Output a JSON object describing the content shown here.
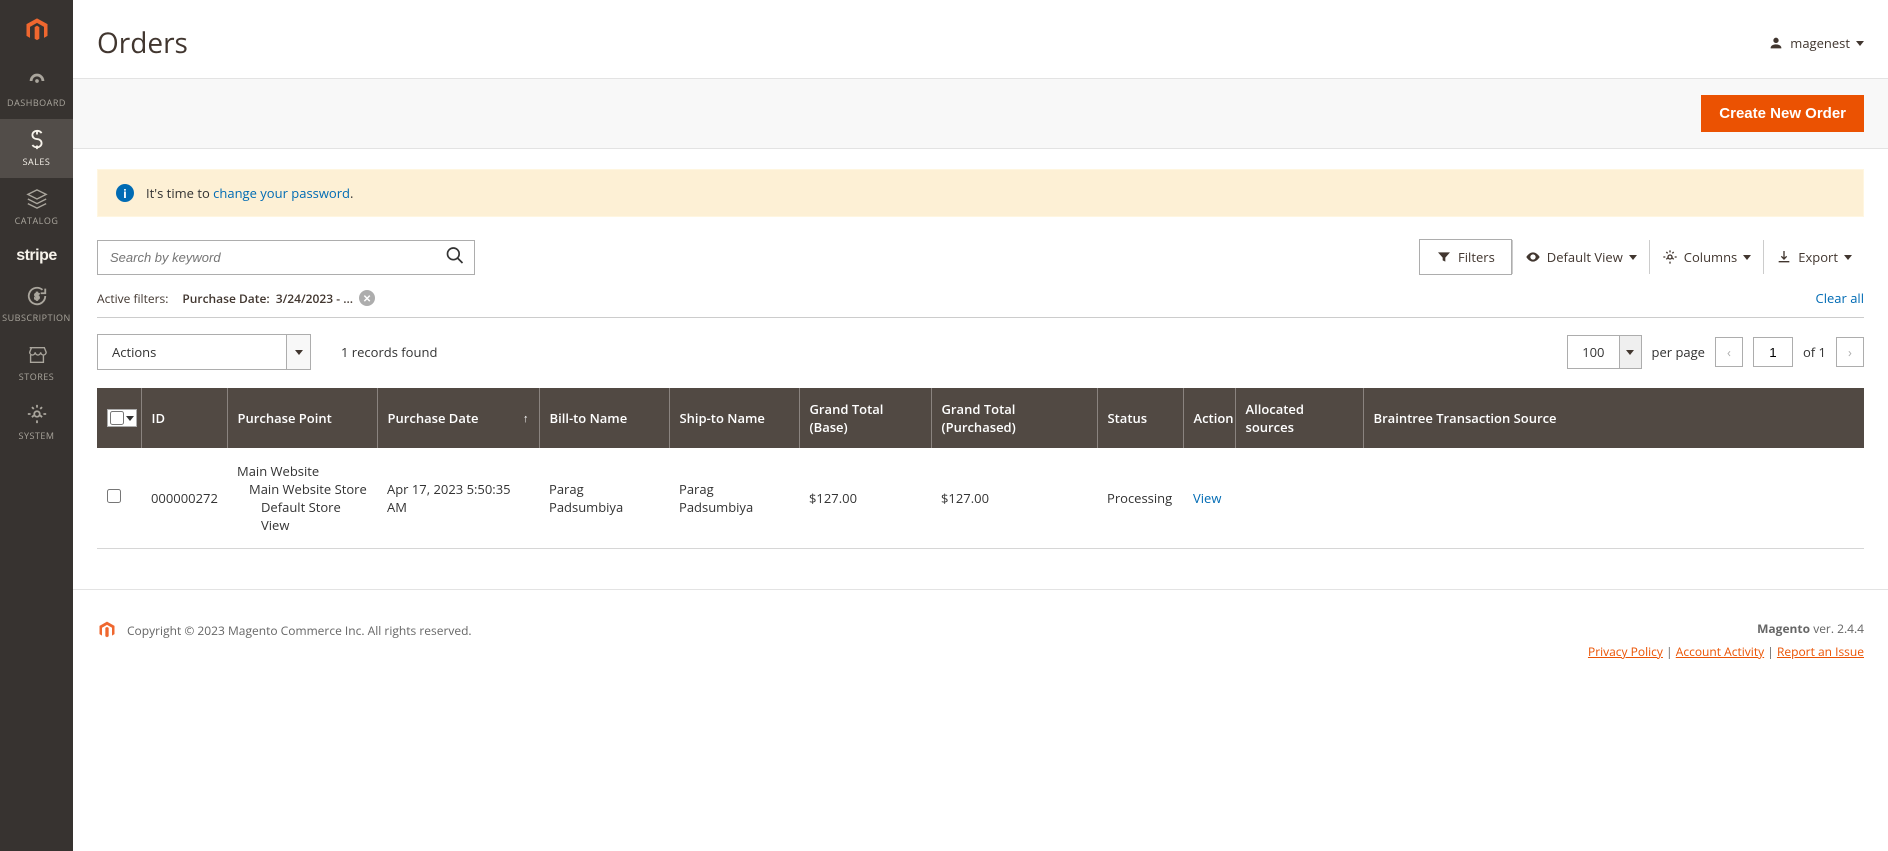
{
  "sidebar": {
    "items": [
      {
        "label": "Dashboard",
        "name": "dashboard"
      },
      {
        "label": "Sales",
        "name": "sales"
      },
      {
        "label": "Catalog",
        "name": "catalog"
      },
      {
        "label": "stripe",
        "name": "stripe"
      },
      {
        "label": "Subscription",
        "name": "subscription"
      },
      {
        "label": "Stores",
        "name": "stores"
      },
      {
        "label": "System",
        "name": "system"
      }
    ]
  },
  "header": {
    "title": "Orders",
    "user_name": "magenest"
  },
  "actions": {
    "create_new_order": "Create New Order"
  },
  "notice": {
    "prefix": "It's time to ",
    "link": "change your password",
    "suffix": "."
  },
  "search": {
    "placeholder": "Search by keyword"
  },
  "toolbar": {
    "filters": "Filters",
    "default_view": "Default View",
    "columns": "Columns",
    "export": "Export"
  },
  "active_filters": {
    "label": "Active filters:",
    "chip_label": "Purchase Date:",
    "chip_value": "3/24/2023 - ...",
    "clear_all": "Clear all"
  },
  "controls": {
    "actions_label": "Actions",
    "records_found": "1 records found",
    "page_size": "100",
    "per_page": "per page",
    "current_page": "1",
    "total_pages": "of 1"
  },
  "table": {
    "headers": {
      "id": "ID",
      "purchase_point": "Purchase Point",
      "purchase_date": "Purchase Date",
      "bill_to": "Bill-to Name",
      "ship_to": "Ship-to Name",
      "gt_base": "Grand Total (Base)",
      "gt_purchased": "Grand Total (Purchased)",
      "status": "Status",
      "action": "Action",
      "allocated": "Allocated sources",
      "braintree": "Braintree Transaction Source"
    },
    "rows": [
      {
        "id": "000000272",
        "pp_line1": "Main Website",
        "pp_line2": "Main Website Store",
        "pp_line3": "Default Store View",
        "purchase_date": "Apr 17, 2023 5:50:35 AM",
        "bill_to": "Parag Padsumbiya",
        "ship_to": "Parag Padsumbiya",
        "gt_base": "$127.00",
        "gt_purchased": "$127.00",
        "status": "Processing",
        "action": "View",
        "allocated": "",
        "braintree": ""
      }
    ]
  },
  "footer": {
    "copyright": "Copyright © 2023 Magento Commerce Inc. All rights reserved.",
    "brand": "Magento",
    "version": " ver. 2.4.4",
    "privacy": "Privacy Policy",
    "account": "Account Activity",
    "report": "Report an Issue"
  }
}
